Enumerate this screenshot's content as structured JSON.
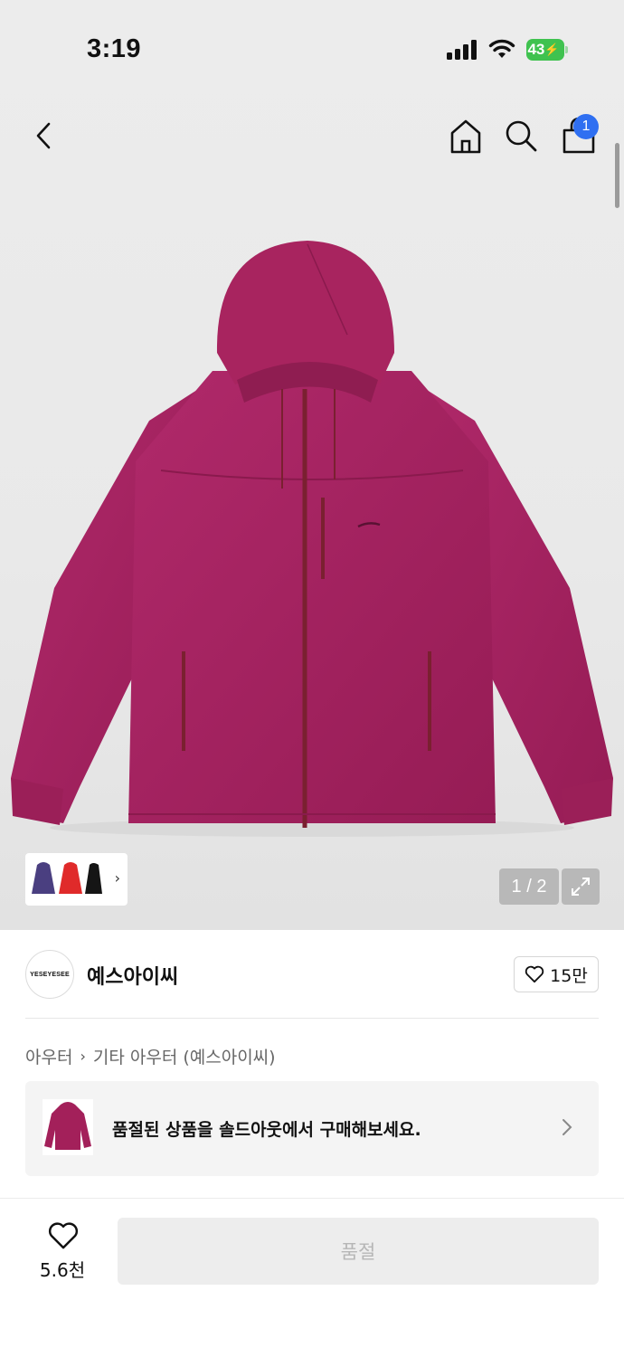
{
  "status_bar": {
    "time": "3:19",
    "battery_level": "43",
    "icons": [
      "cellular-signal-icon",
      "wifi-icon",
      "battery-charging-icon"
    ]
  },
  "nav": {
    "icons": [
      "back-chevron-icon",
      "home-icon",
      "search-icon",
      "shopping-bag-icon"
    ],
    "cart_badge": "1"
  },
  "gallery": {
    "counter": "1 / 2",
    "accent_color": "#a3205a",
    "thumbnail_colors": [
      "#4a3f80",
      "#e02a2a",
      "#151515"
    ]
  },
  "brand": {
    "logo_text": "YESEYESEE",
    "name": "예스아이씨",
    "like_count": "15만"
  },
  "breadcrumb": {
    "items": [
      "아우터",
      "기타 아우터 (예스아이씨)"
    ]
  },
  "soldout_banner": {
    "text": "품절된 상품을 솔드아웃에서 구매해보세요."
  },
  "bottom_bar": {
    "wish_count": "5.6천",
    "buy_button_label": "품절"
  }
}
